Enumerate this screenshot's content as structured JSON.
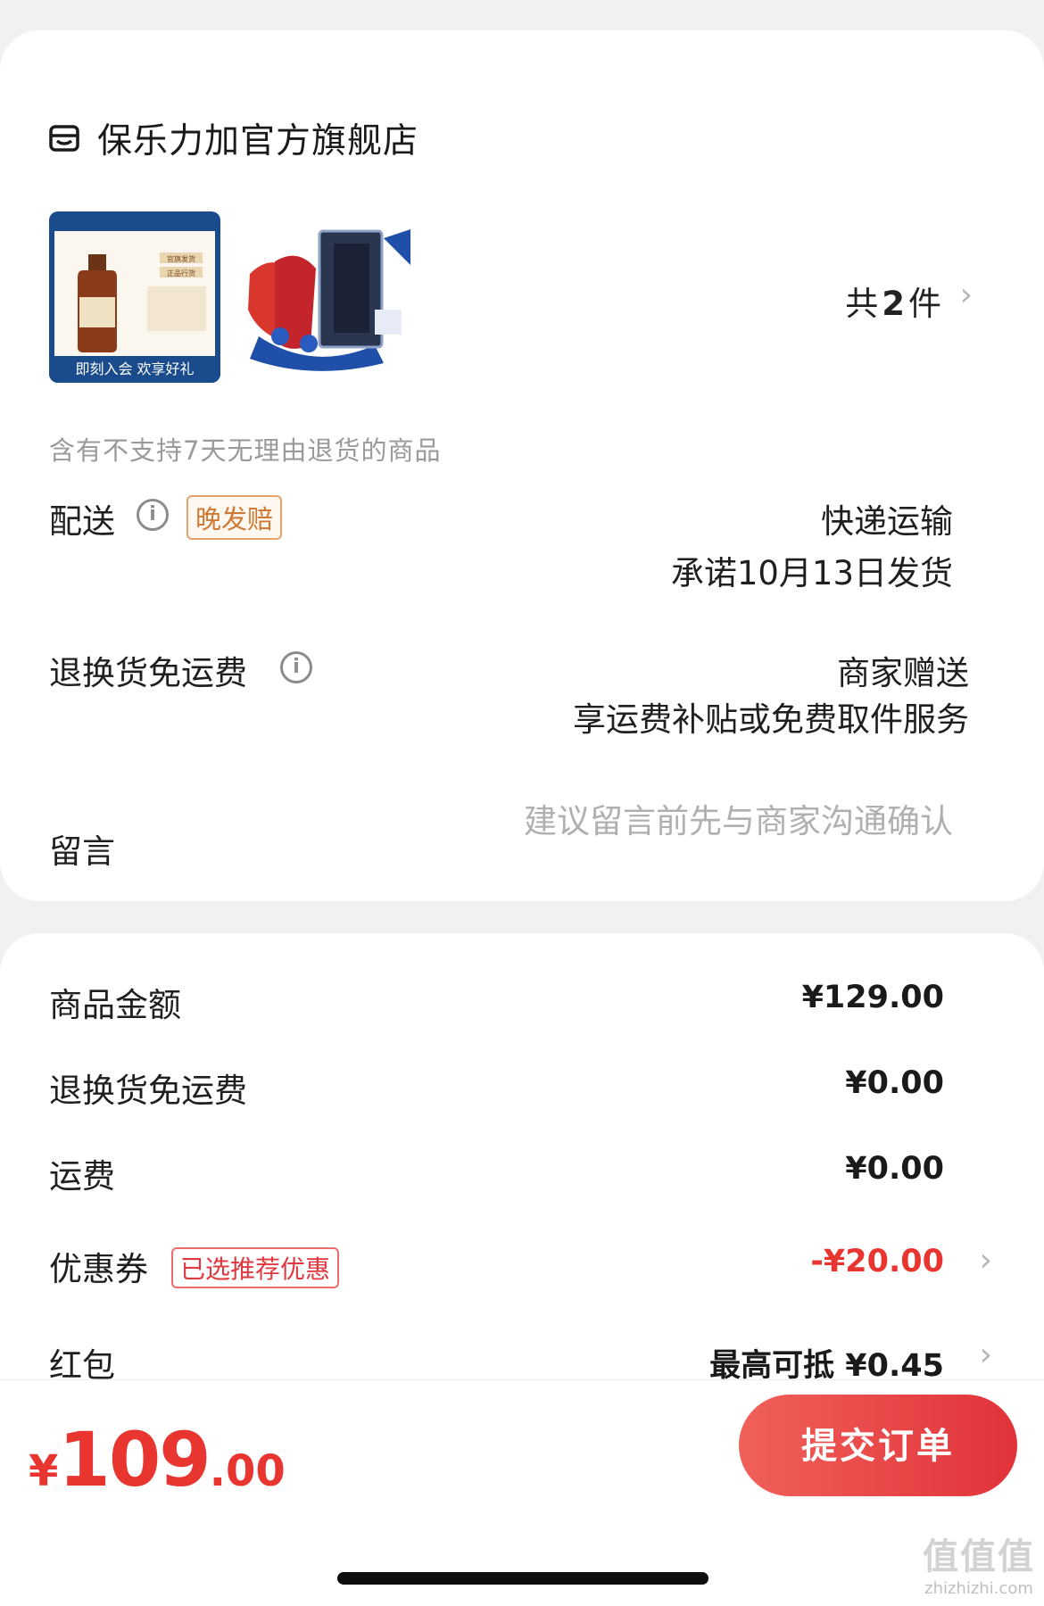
{
  "store": {
    "name": "保乐力加官方旗舰店",
    "item_count_prefix": "共",
    "item_count": "2",
    "item_count_suffix": "件",
    "notice": "含有不支持7天无理由退货的商品",
    "thumb1_banner": "即刻入会 欢享好礼",
    "thumb1_tag1": "官旗发货",
    "thumb1_tag2": "正品行货"
  },
  "delivery": {
    "label": "配送",
    "tag": "晚发赔",
    "method": "快递运输",
    "promise": "承诺10月13日发货"
  },
  "return_shipping": {
    "label": "退换货免运费",
    "value_line1": "商家赠送",
    "value_line2": "享运费补贴或免费取件服务"
  },
  "message": {
    "label": "留言",
    "placeholder": "建议留言前先与商家沟通确认"
  },
  "pricing": {
    "goods_label": "商品金额",
    "goods_value": "¥129.00",
    "return_label": "退换货免运费",
    "return_value": "¥0.00",
    "shipping_label": "运费",
    "shipping_value": "¥0.00",
    "coupon_label": "优惠券",
    "coupon_tag": "已选推荐优惠",
    "coupon_value": "-¥20.00",
    "redpacket_label": "红包",
    "redpacket_value": "最高可抵 ¥0.45"
  },
  "bottom": {
    "currency": "¥",
    "total_int": "109",
    "total_dec": ".00",
    "submit_label": "提交订单"
  },
  "watermark": {
    "main": "值值值",
    "site": "zhizhizhi.com"
  },
  "colors": {
    "accent_red": "#e8352f",
    "tag_orange": "#cf7a34",
    "background": "#f1f1f1"
  }
}
